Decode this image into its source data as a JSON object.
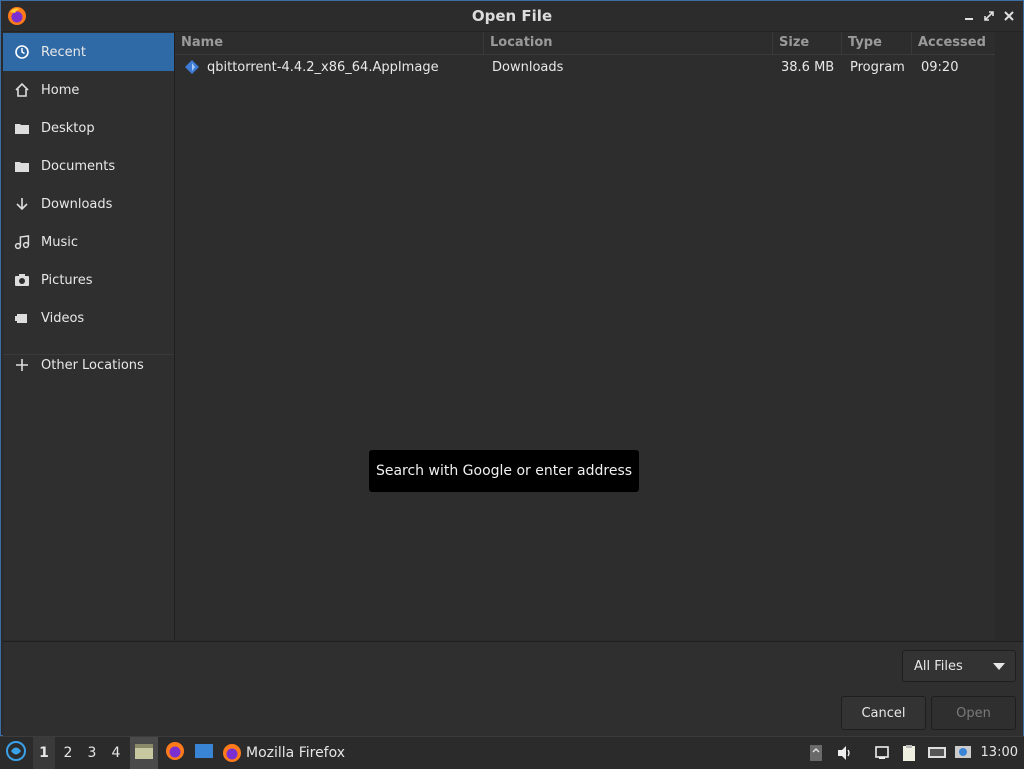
{
  "window": {
    "title": "Open File"
  },
  "sidebar": {
    "items": [
      {
        "label": "Recent",
        "icon": "clock-icon",
        "active": true
      },
      {
        "label": "Home",
        "icon": "home-icon"
      },
      {
        "label": "Desktop",
        "icon": "folder-icon"
      },
      {
        "label": "Documents",
        "icon": "folder-icon"
      },
      {
        "label": "Downloads",
        "icon": "download-arrow-icon"
      },
      {
        "label": "Music",
        "icon": "music-note-icon"
      },
      {
        "label": "Pictures",
        "icon": "camera-icon"
      },
      {
        "label": "Videos",
        "icon": "video-icon"
      }
    ],
    "other_locations": "Other Locations"
  },
  "filelist": {
    "columns": {
      "name": "Name",
      "location": "Location",
      "size": "Size",
      "type": "Type",
      "accessed": "Accessed"
    },
    "rows": [
      {
        "name": "qbittorrent-4.4.2_x86_64.AppImage",
        "location": "Downloads",
        "size": "38.6 MB",
        "type": "Program",
        "accessed": "09:20"
      }
    ]
  },
  "tooltip": {
    "text": "Search with Google or enter address"
  },
  "footer": {
    "filter_value": "All Files",
    "cancel_label": "Cancel",
    "open_label": "Open"
  },
  "taskbar": {
    "workspaces": [
      "1",
      "2",
      "3",
      "4"
    ],
    "active_workspace": "1",
    "window_label": "Mozilla Firefox",
    "clock": "13:00"
  },
  "colors": {
    "accent": "#2f6aa7",
    "background": "#2b2b2b"
  }
}
